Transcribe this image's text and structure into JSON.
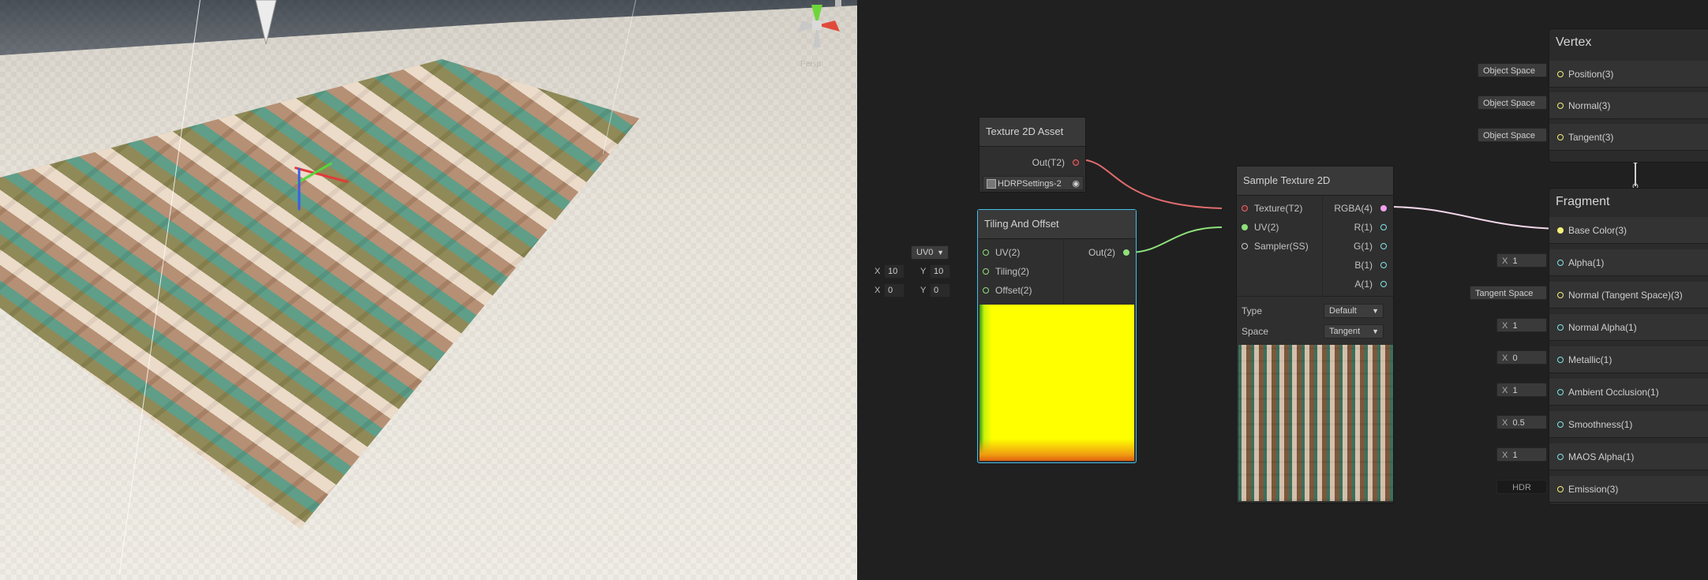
{
  "scene": {
    "persp_label": "Persp"
  },
  "nodes": {
    "texture_asset": {
      "title": "Texture 2D Asset",
      "out_label": "Out(T2)",
      "asset_name": "HDRPSettings-2"
    },
    "tiling_offset": {
      "title": "Tiling And Offset",
      "uv_label": "UV(2)",
      "tiling_label": "Tiling(2)",
      "offset_label": "Offset(2)",
      "out_label": "Out(2)",
      "uv_channel": "UV0",
      "tiling_x": "10",
      "tiling_y": "10",
      "offset_x": "0",
      "offset_y": "0",
      "x_label": "X",
      "y_label": "Y"
    },
    "sample_texture": {
      "title": "Sample Texture 2D",
      "inputs": [
        "Texture(T2)",
        "UV(2)",
        "Sampler(SS)"
      ],
      "outputs": [
        "RGBA(4)",
        "R(1)",
        "G(1)",
        "B(1)",
        "A(1)"
      ],
      "type_label": "Type",
      "type_value": "Default",
      "space_label": "Space",
      "space_value": "Tangent"
    }
  },
  "vertex": {
    "title": "Vertex",
    "rows": [
      {
        "label": "Position(3)",
        "value": "Object Space"
      },
      {
        "label": "Normal(3)",
        "value": "Object Space"
      },
      {
        "label": "Tangent(3)",
        "value": "Object Space"
      }
    ]
  },
  "fragment": {
    "title": "Fragment",
    "rows": [
      {
        "label": "Base Color(3)",
        "value": ""
      },
      {
        "label": "Alpha(1)",
        "value": "1",
        "x": "X"
      },
      {
        "label": "Normal (Tangent Space)(3)",
        "value": "Tangent Space"
      },
      {
        "label": "Normal Alpha(1)",
        "value": "1",
        "x": "X"
      },
      {
        "label": "Metallic(1)",
        "value": "0",
        "x": "X"
      },
      {
        "label": "Ambient Occlusion(1)",
        "value": "1",
        "x": "X"
      },
      {
        "label": "Smoothness(1)",
        "value": "0.5",
        "x": "X"
      },
      {
        "label": "MAOS Alpha(1)",
        "value": "1",
        "x": "X"
      },
      {
        "label": "Emission(3)",
        "value": "HDR"
      }
    ]
  },
  "colors": {
    "texture_port": "#e06c6c",
    "vec2_port": "#8fe07b",
    "vec4_port": "#f0a0ee",
    "vec3_port": "#f4f07a",
    "float_port": "#84e4e7",
    "selection": "#44c0e8"
  }
}
